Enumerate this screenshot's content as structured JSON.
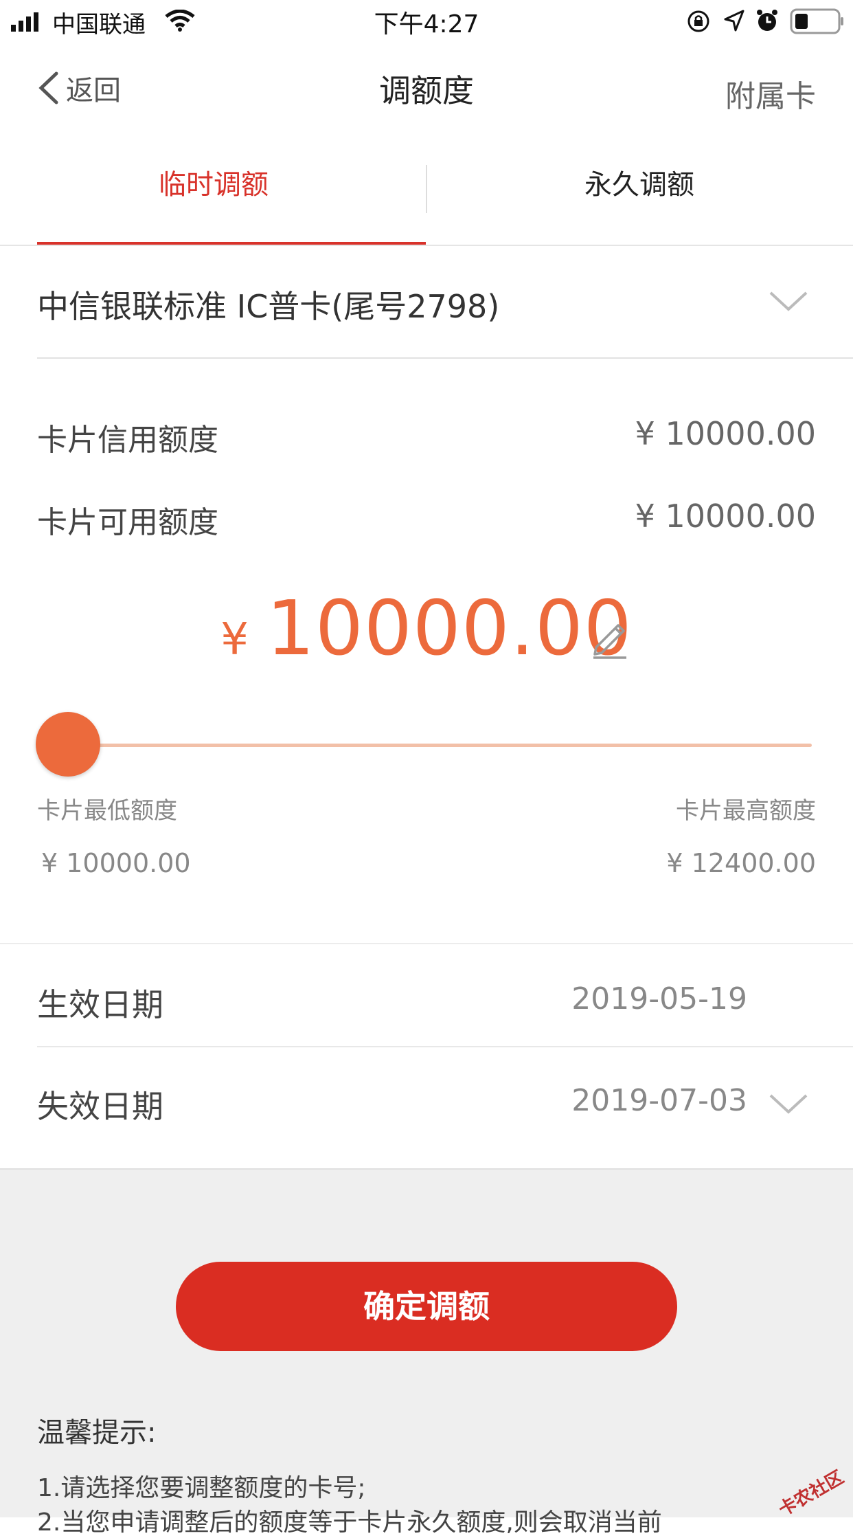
{
  "status_bar": {
    "carrier": "中国联通",
    "time": "下午4:27"
  },
  "nav": {
    "back_label": "返回",
    "title": "调额度",
    "right_label": "附属卡"
  },
  "tabs": [
    {
      "label": "临时调额",
      "active": true
    },
    {
      "label": "永久调额",
      "active": false
    }
  ],
  "card": {
    "name": "中信银联标准  IC普卡(尾号2798)"
  },
  "info": {
    "credit_limit_label": "卡片信用额度",
    "credit_limit_value": "¥  10000.00",
    "available_limit_label": "卡片可用额度",
    "available_limit_value": "¥  10000.00"
  },
  "adjust": {
    "currency": "¥",
    "amount": "10000.00",
    "min_label": "卡片最低额度",
    "min_value": "¥  10000.00",
    "max_label": "卡片最高额度",
    "max_value": "¥  12400.00",
    "slider_fraction": 0.0
  },
  "dates": {
    "effective_label": "生效日期",
    "effective_value": "2019-05-19",
    "expiry_label": "失效日期",
    "expiry_value": "2019-07-03"
  },
  "confirm_label": "确定调额",
  "tips": {
    "title": "温馨提示:",
    "lines": [
      "1.请选择您要调整额度的卡号;",
      "2.当您申请调整后的额度等于卡片永久额度,则会取消当前"
    ]
  },
  "watermark": "卡农社区",
  "colors": {
    "accent_red": "#da2d22",
    "amount_orange": "#ec6a3c"
  }
}
